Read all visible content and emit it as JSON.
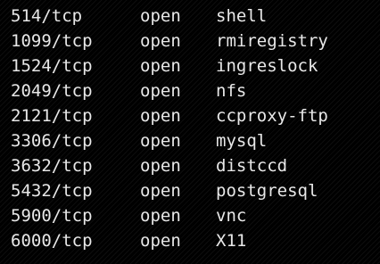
{
  "terminal": {
    "rows": [
      {
        "port": "514/tcp",
        "state": "open",
        "service": "shell"
      },
      {
        "port": "1099/tcp",
        "state": "open",
        "service": "rmiregistry"
      },
      {
        "port": "1524/tcp",
        "state": "open",
        "service": "ingreslock"
      },
      {
        "port": "2049/tcp",
        "state": "open",
        "service": "nfs"
      },
      {
        "port": "2121/tcp",
        "state": "open",
        "service": "ccproxy-ftp"
      },
      {
        "port": "3306/tcp",
        "state": "open",
        "service": "mysql"
      },
      {
        "port": "3632/tcp",
        "state": "open",
        "service": "distccd"
      },
      {
        "port": "5432/tcp",
        "state": "open",
        "service": "postgresql"
      },
      {
        "port": "5900/tcp",
        "state": "open",
        "service": "vnc"
      },
      {
        "port": "6000/tcp",
        "state": "open",
        "service": "X11"
      }
    ]
  }
}
